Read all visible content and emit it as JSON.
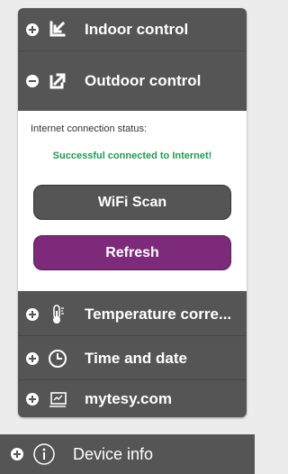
{
  "menu": {
    "indoor": {
      "label": "Indoor control",
      "toggle": "plus",
      "icon": "arrow-down-left-icon"
    },
    "outdoor": {
      "label": "Outdoor control",
      "toggle": "minus",
      "icon": "arrow-up-right-icon"
    },
    "temperature": {
      "label": "Temperature corre...",
      "toggle": "plus",
      "icon": "thermometer-icon"
    },
    "time": {
      "label": "Time and date",
      "toggle": "plus",
      "icon": "clock-icon"
    },
    "mytesy": {
      "label": "mytesy.com",
      "toggle": "plus",
      "icon": "monitor-icon"
    }
  },
  "outdoor_panel": {
    "status_label": "Internet connection status:",
    "status_value": "Successful connected to Internet!",
    "wifi_scan_label": "WiFi Scan",
    "refresh_label": "Refresh"
  },
  "device_info": {
    "label": "Device info",
    "toggle": "plus",
    "icon": "info-icon"
  },
  "colors": {
    "panel": "#555555",
    "success": "#1e9b4e",
    "refresh_button": "#7d2a7b"
  }
}
